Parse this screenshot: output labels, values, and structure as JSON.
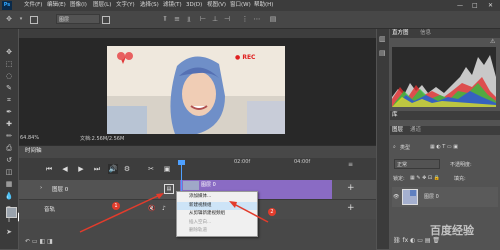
{
  "app": {
    "logo": "Ps"
  },
  "menu": [
    "文件(F)",
    "编辑(E)",
    "图像(I)",
    "图层(L)",
    "文字(Y)",
    "选择(S)",
    "滤镜(T)",
    "3D(D)",
    "视图(V)",
    "窗口(W)",
    "帮助(H)"
  ],
  "window_controls": {
    "minimize": "—",
    "maximize": "□",
    "close": "✕"
  },
  "options_bar": {
    "layer_dropdown": "图层"
  },
  "canvas": {
    "rec_text": "● REC"
  },
  "status": {
    "zoom": "64.84%",
    "doc_size": "文档:2.56M/2.56M"
  },
  "timeline": {
    "tab_label": "时间轴",
    "ruler": [
      "02:00f",
      "04:00f"
    ],
    "track1_label": "图层 0",
    "track2_label": "音轨",
    "clip_label": "图层 0"
  },
  "context_menu": {
    "items": [
      "添加媒体...",
      "新建视频组",
      "从剪辑新建视频组",
      "插入空白...",
      "删除轨道"
    ]
  },
  "annotations": {
    "badge1": "1",
    "badge2": "2"
  },
  "right_panel": {
    "histogram_tabs": [
      "直方图",
      "信息"
    ],
    "library_tab": "库",
    "layers_tabs": [
      "图层",
      "通道"
    ],
    "search_kind": "类型",
    "blend_mode": "正常",
    "opacity_label": "不透明度:",
    "fill_label": "填充:",
    "lock_label": "锁定:",
    "layer_name": "图层 0"
  },
  "watermark": "百度经验",
  "colors": {
    "accent_blue": "#4ea0ff",
    "clip_purple": "#8a6bc4",
    "annotation_red": "#e23c2c"
  }
}
